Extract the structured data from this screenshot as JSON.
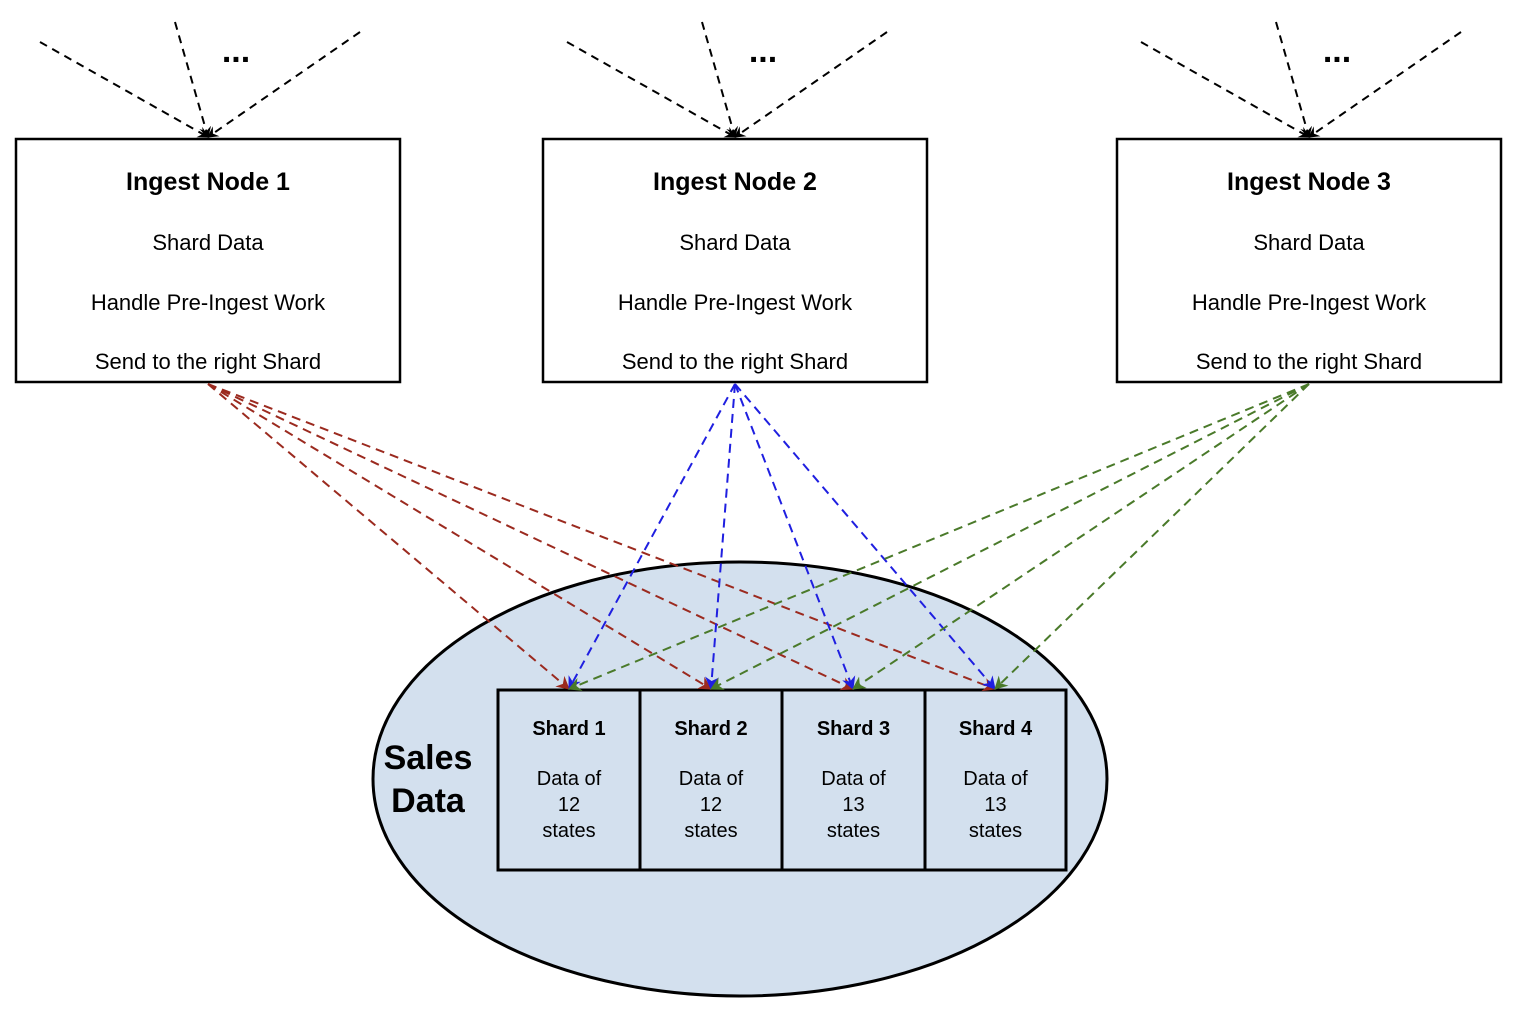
{
  "diagram": {
    "ingest_nodes": [
      {
        "title": "Ingest Node 1",
        "lines": [
          "Shard Data",
          "Handle Pre-Ingest Work",
          "Send to the right Shard"
        ],
        "ellipsis": "...",
        "edge_color": "#9b2a1f"
      },
      {
        "title": "Ingest Node 2",
        "lines": [
          "Shard Data",
          "Handle Pre-Ingest Work",
          "Send to the right Shard"
        ],
        "ellipsis": "...",
        "edge_color": "#1f1fe0"
      },
      {
        "title": "Ingest Node 3",
        "lines": [
          "Shard Data",
          "Handle Pre-Ingest Work",
          "Send to the right Shard"
        ],
        "ellipsis": "...",
        "edge_color": "#4a7a2a"
      }
    ],
    "database": {
      "label_line1": "Sales",
      "label_line2": "Data",
      "fill": "#d3e0ee"
    },
    "shards": [
      {
        "title": "Shard 1",
        "line1": "Data of",
        "line2": "12",
        "line3": "states"
      },
      {
        "title": "Shard 2",
        "line1": "Data of",
        "line2": "12",
        "line3": "states"
      },
      {
        "title": "Shard 3",
        "line1": "Data of",
        "line2": "13",
        "line3": "states"
      },
      {
        "title": "Shard 4",
        "line1": "Data of",
        "line2": "13",
        "line3": "states"
      }
    ]
  }
}
